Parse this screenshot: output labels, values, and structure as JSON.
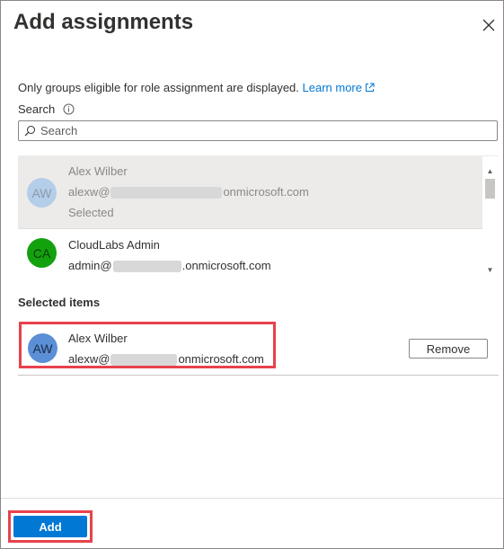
{
  "panel": {
    "title": "Add assignments",
    "close_icon": "close-icon"
  },
  "info": {
    "text": "Only groups eligible for role assignment are displayed.",
    "link_label": "Learn more",
    "link_icon": "external-link-icon"
  },
  "search": {
    "label": "Search",
    "info_icon": "info-icon",
    "placeholder": "Search",
    "value": "",
    "icon": "search-icon"
  },
  "results": [
    {
      "initials": "AW",
      "name": "Alex Wilber",
      "email_prefix": "alexw@",
      "email_suffix": "onmicrosoft.com",
      "status": "Selected",
      "avatar_color": "#b4cde8"
    },
    {
      "initials": "CA",
      "name": "CloudLabs Admin",
      "email_prefix": "admin@",
      "email_suffix": ".onmicrosoft.com",
      "status": "",
      "avatar_color": "#13a10e"
    }
  ],
  "selected": {
    "heading": "Selected items",
    "items": [
      {
        "initials": "AW",
        "name": "Alex Wilber",
        "email_prefix": "alexw@",
        "email_suffix": "onmicrosoft.com",
        "avatar_color": "#5b8fd6",
        "remove_label": "Remove"
      }
    ]
  },
  "footer": {
    "add_label": "Add"
  },
  "colors": {
    "accent": "#0078d4",
    "highlight": "#e8424b"
  }
}
